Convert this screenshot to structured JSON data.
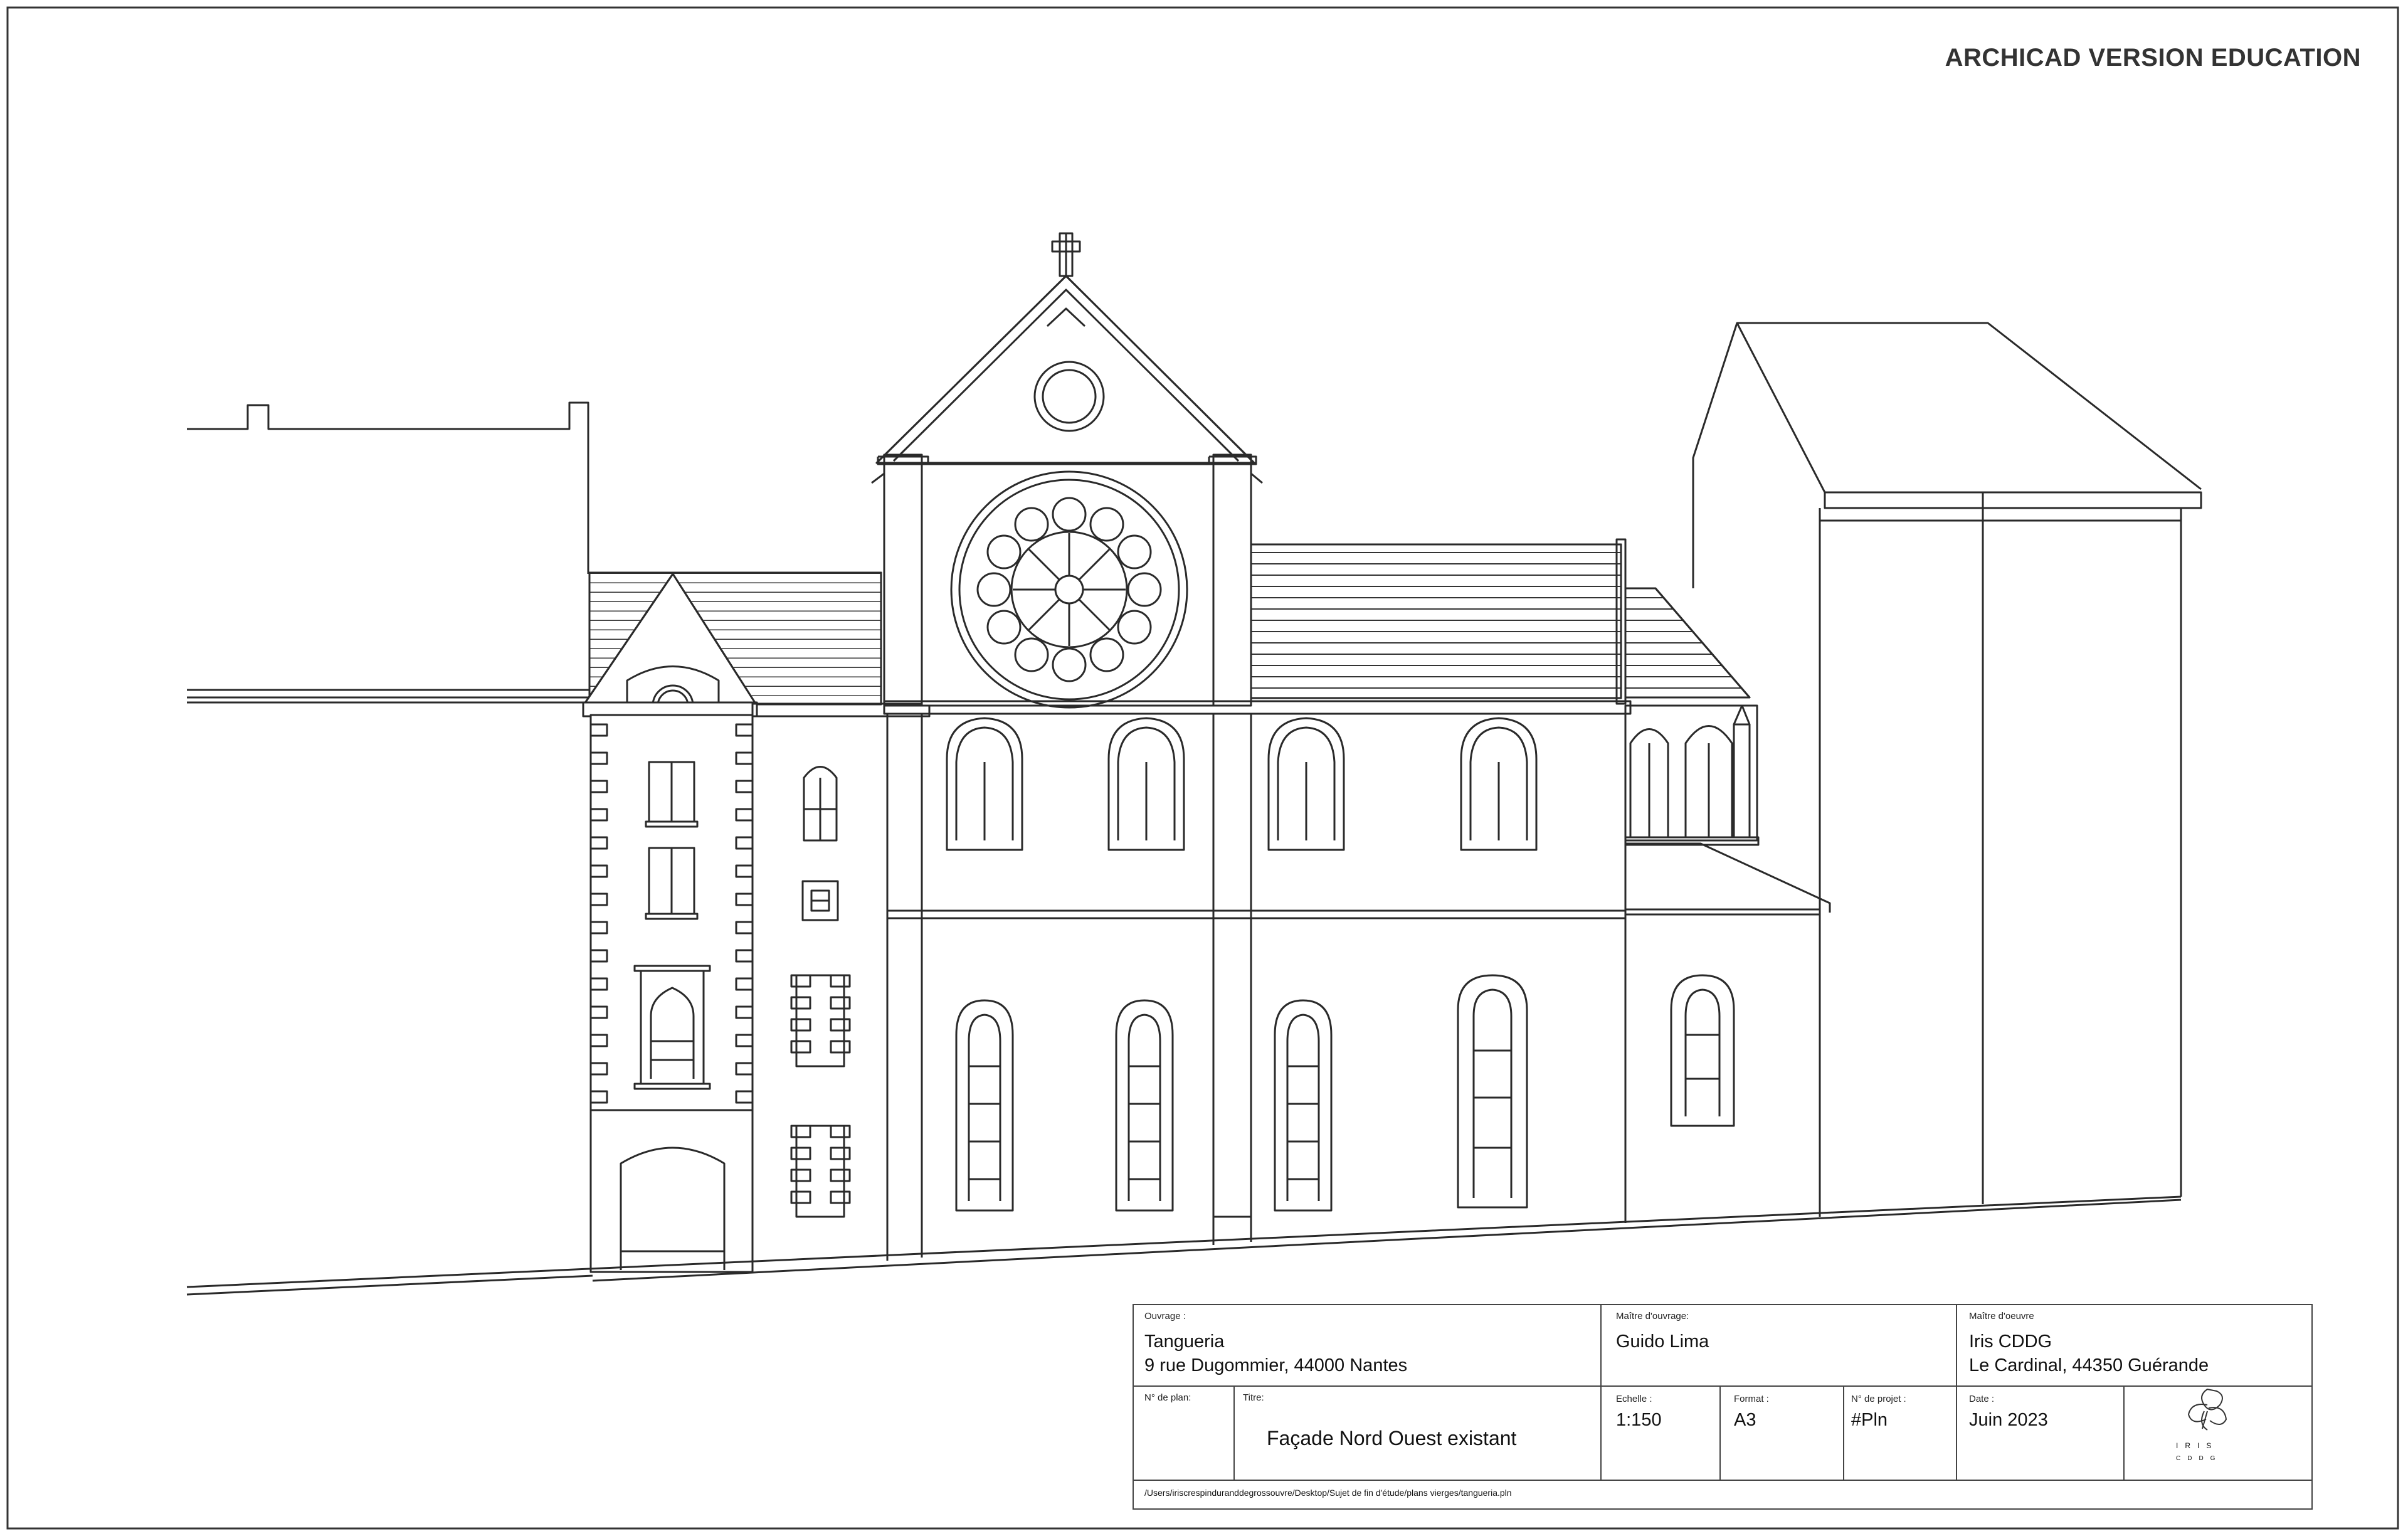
{
  "watermark": "ARCHICAD VERSION EDUCATION",
  "title_block": {
    "ouvrage_label": "Ouvrage :",
    "ouvrage_name": "Tangueria",
    "ouvrage_address": "9 rue Dugommier, 44000 Nantes",
    "maitre_ouvrage_label": "Maître d'ouvrage:",
    "maitre_ouvrage_value": "Guido Lima",
    "maitre_oeuvre_label": "Maître d'oeuvre",
    "maitre_oeuvre_name": "Iris CDDG",
    "maitre_oeuvre_address": "Le Cardinal, 44350 Guérande",
    "plan_no_label": "N° de plan:",
    "titre_label": "Titre:",
    "titre_value": "Façade Nord Ouest existant",
    "echelle_label": "Echelle :",
    "echelle_value": "1:150",
    "format_label": "Format :",
    "format_value": "A3",
    "projet_label": "N° de projet :",
    "projet_value": "#Pln",
    "date_label": "Date :",
    "date_value": "Juin 2023",
    "file_path": "/Users/iriscrespindurandde​grossouvre/Desktop/Sujet de fin d'étude/plans vierges/tangueria.pln",
    "logo_top": "IRIS",
    "logo_bottom": "CDDG"
  },
  "colors": {
    "line": "#2a2a2a",
    "background": "#ffffff"
  }
}
